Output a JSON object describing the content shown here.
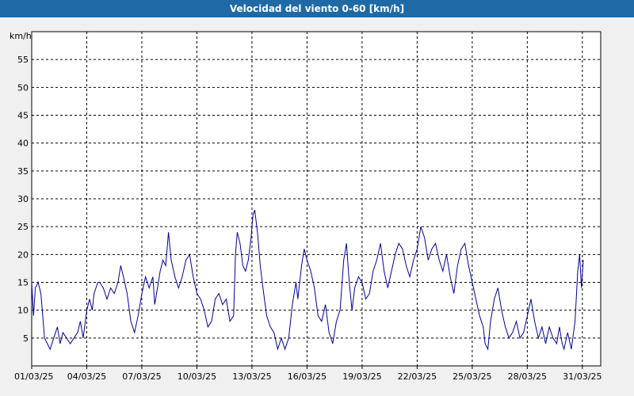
{
  "window": {
    "title": "Velocidad del viento 0-60 [km/h]"
  },
  "chart_data": {
    "type": "line",
    "title": "Velocidad del viento 0-60 [km/h]",
    "ylabel": "km/h",
    "xlabel": "",
    "ylim": [
      0,
      60
    ],
    "xlim_days": [
      0,
      31
    ],
    "y_ticks": [
      5,
      10,
      15,
      20,
      25,
      30,
      35,
      40,
      45,
      50,
      55
    ],
    "x_ticks": [
      {
        "day": 0,
        "label": "01/03/25"
      },
      {
        "day": 3,
        "label": "04/03/25"
      },
      {
        "day": 6,
        "label": "07/03/25"
      },
      {
        "day": 9,
        "label": "10/03/25"
      },
      {
        "day": 12,
        "label": "13/03/25"
      },
      {
        "day": 15,
        "label": "16/03/25"
      },
      {
        "day": 18,
        "label": "19/03/25"
      },
      {
        "day": 21,
        "label": "22/03/25"
      },
      {
        "day": 24,
        "label": "25/03/25"
      },
      {
        "day": 27,
        "label": "28/03/25"
      },
      {
        "day": 30,
        "label": "31/03/25"
      }
    ],
    "grid": true,
    "line_color": "#0000a0",
    "series": [
      {
        "name": "",
        "points": [
          [
            0.0,
            15
          ],
          [
            0.1,
            9
          ],
          [
            0.2,
            14
          ],
          [
            0.35,
            15
          ],
          [
            0.5,
            13
          ],
          [
            0.6,
            9
          ],
          [
            0.7,
            5
          ],
          [
            0.85,
            4
          ],
          [
            1.0,
            3
          ],
          [
            1.2,
            5
          ],
          [
            1.4,
            7
          ],
          [
            1.55,
            4
          ],
          [
            1.7,
            6
          ],
          [
            1.9,
            5
          ],
          [
            2.1,
            4
          ],
          [
            2.3,
            5
          ],
          [
            2.5,
            6
          ],
          [
            2.65,
            8
          ],
          [
            2.8,
            5
          ],
          [
            3.0,
            10
          ],
          [
            3.15,
            12
          ],
          [
            3.3,
            10
          ],
          [
            3.4,
            13
          ],
          [
            3.6,
            15
          ],
          [
            3.7,
            15
          ],
          [
            3.9,
            14
          ],
          [
            4.1,
            12
          ],
          [
            4.3,
            14
          ],
          [
            4.5,
            13
          ],
          [
            4.7,
            15
          ],
          [
            4.85,
            18
          ],
          [
            5.0,
            16
          ],
          [
            5.2,
            13
          ],
          [
            5.4,
            8
          ],
          [
            5.6,
            6
          ],
          [
            5.8,
            9
          ],
          [
            6.0,
            13
          ],
          [
            6.2,
            16
          ],
          [
            6.4,
            14
          ],
          [
            6.6,
            16
          ],
          [
            6.7,
            11
          ],
          [
            6.85,
            14
          ],
          [
            7.0,
            17
          ],
          [
            7.15,
            19
          ],
          [
            7.3,
            18
          ],
          [
            7.45,
            24
          ],
          [
            7.6,
            19
          ],
          [
            7.8,
            16
          ],
          [
            8.0,
            14
          ],
          [
            8.2,
            16
          ],
          [
            8.4,
            19
          ],
          [
            8.6,
            20
          ],
          [
            8.8,
            16
          ],
          [
            9.0,
            13
          ],
          [
            9.2,
            12
          ],
          [
            9.4,
            10
          ],
          [
            9.6,
            7
          ],
          [
            9.8,
            8
          ],
          [
            10.0,
            12
          ],
          [
            10.2,
            13
          ],
          [
            10.4,
            11
          ],
          [
            10.6,
            12
          ],
          [
            10.8,
            8
          ],
          [
            11.0,
            9
          ],
          [
            11.1,
            20
          ],
          [
            11.2,
            24
          ],
          [
            11.35,
            22
          ],
          [
            11.5,
            18
          ],
          [
            11.65,
            17
          ],
          [
            11.8,
            19
          ],
          [
            11.95,
            23
          ],
          [
            12.05,
            27
          ],
          [
            12.15,
            28
          ],
          [
            12.3,
            24
          ],
          [
            12.45,
            18
          ],
          [
            12.6,
            14
          ],
          [
            12.8,
            9
          ],
          [
            13.0,
            7
          ],
          [
            13.2,
            6
          ],
          [
            13.4,
            3
          ],
          [
            13.6,
            5
          ],
          [
            13.8,
            3
          ],
          [
            14.0,
            5
          ],
          [
            14.2,
            11
          ],
          [
            14.4,
            15
          ],
          [
            14.5,
            12
          ],
          [
            14.7,
            18
          ],
          [
            14.85,
            21
          ],
          [
            15.0,
            19
          ],
          [
            15.2,
            17
          ],
          [
            15.4,
            14
          ],
          [
            15.6,
            9
          ],
          [
            15.8,
            8
          ],
          [
            16.0,
            11
          ],
          [
            16.2,
            6
          ],
          [
            16.4,
            4
          ],
          [
            16.6,
            8
          ],
          [
            16.8,
            10
          ],
          [
            17.0,
            19
          ],
          [
            17.15,
            22
          ],
          [
            17.3,
            15
          ],
          [
            17.45,
            10
          ],
          [
            17.6,
            14
          ],
          [
            17.8,
            16
          ],
          [
            18.0,
            15
          ],
          [
            18.2,
            12
          ],
          [
            18.4,
            13
          ],
          [
            18.6,
            17
          ],
          [
            18.8,
            19
          ],
          [
            19.0,
            22
          ],
          [
            19.2,
            17
          ],
          [
            19.4,
            14
          ],
          [
            19.6,
            17
          ],
          [
            19.8,
            20
          ],
          [
            20.0,
            22
          ],
          [
            20.2,
            21
          ],
          [
            20.4,
            18
          ],
          [
            20.6,
            16
          ],
          [
            20.8,
            19
          ],
          [
            21.0,
            21
          ],
          [
            21.2,
            25
          ],
          [
            21.4,
            23
          ],
          [
            21.6,
            19
          ],
          [
            21.8,
            21
          ],
          [
            22.0,
            22
          ],
          [
            22.2,
            19
          ],
          [
            22.4,
            17
          ],
          [
            22.6,
            20
          ],
          [
            22.8,
            16
          ],
          [
            23.0,
            13
          ],
          [
            23.2,
            18
          ],
          [
            23.4,
            21
          ],
          [
            23.6,
            22
          ],
          [
            23.8,
            18
          ],
          [
            24.0,
            15
          ],
          [
            24.2,
            12
          ],
          [
            24.4,
            9
          ],
          [
            24.6,
            7
          ],
          [
            24.7,
            4
          ],
          [
            24.85,
            3
          ],
          [
            25.0,
            8
          ],
          [
            25.2,
            12
          ],
          [
            25.4,
            14
          ],
          [
            25.6,
            10
          ],
          [
            25.8,
            7
          ],
          [
            26.0,
            5
          ],
          [
            26.2,
            6
          ],
          [
            26.4,
            8
          ],
          [
            26.6,
            5
          ],
          [
            26.8,
            6
          ],
          [
            27.0,
            9
          ],
          [
            27.2,
            12
          ],
          [
            27.4,
            8
          ],
          [
            27.6,
            5
          ],
          [
            27.8,
            7
          ],
          [
            28.0,
            4
          ],
          [
            28.2,
            7
          ],
          [
            28.4,
            5
          ],
          [
            28.6,
            4
          ],
          [
            28.75,
            7
          ],
          [
            28.9,
            4
          ],
          [
            29.0,
            3
          ],
          [
            29.2,
            6
          ],
          [
            29.4,
            3
          ],
          [
            29.6,
            8
          ],
          [
            29.75,
            17
          ],
          [
            29.85,
            20
          ],
          [
            29.95,
            14
          ],
          [
            30.05,
            19
          ]
        ]
      }
    ]
  }
}
